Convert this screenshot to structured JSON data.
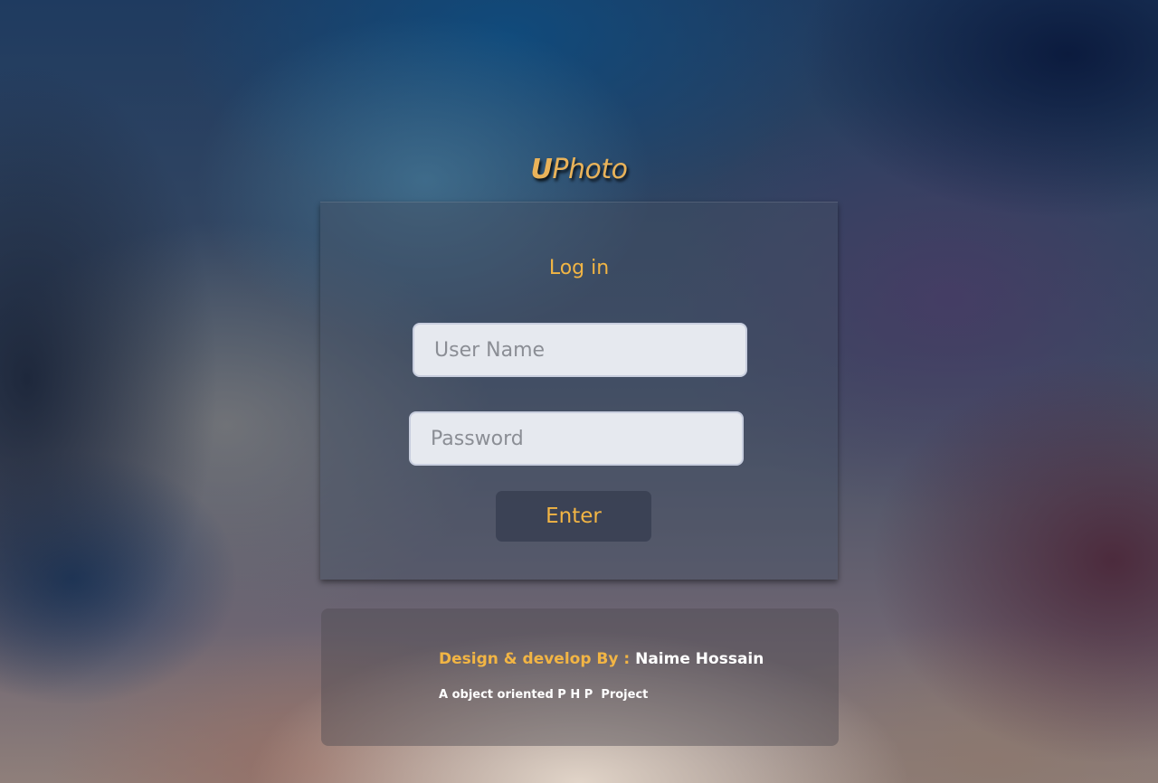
{
  "logo": {
    "first": "U",
    "rest": "Photo"
  },
  "login": {
    "title": "Log in",
    "username_placeholder": "User Name",
    "password_placeholder": "Password",
    "enter_label": "Enter"
  },
  "footer": {
    "credit_label": "Design & develop By :",
    "credit_name": "Naime Hossain",
    "project_text": "A object oriented P H P  Project"
  },
  "colors": {
    "accent": "#f2b544",
    "logo": "#e9b35a",
    "input_bg": "#e6e9ef",
    "button_bg": "#373e50"
  }
}
